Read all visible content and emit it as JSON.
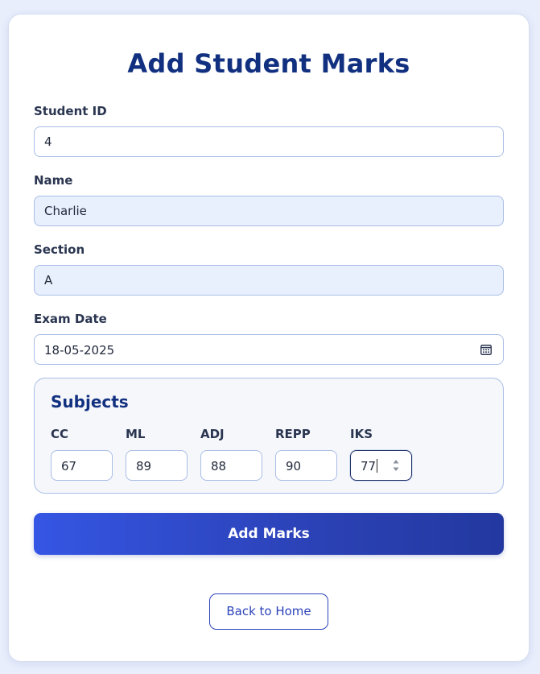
{
  "page": {
    "title": "Add Student Marks"
  },
  "form": {
    "student_id": {
      "label": "Student ID",
      "value": "4"
    },
    "name": {
      "label": "Name",
      "value": "Charlie"
    },
    "section": {
      "label": "Section",
      "value": "A"
    },
    "exam_date": {
      "label": "Exam Date",
      "value": "18-05-2025",
      "icon": "calendar-icon"
    }
  },
  "subjects": {
    "heading": "Subjects",
    "items": [
      {
        "label": "CC",
        "value": "67"
      },
      {
        "label": "ML",
        "value": "89"
      },
      {
        "label": "ADJ",
        "value": "88"
      },
      {
        "label": "REPP",
        "value": "90"
      },
      {
        "label": "IKS",
        "value": "77",
        "focused": true
      }
    ]
  },
  "actions": {
    "submit_label": "Add Marks",
    "back_label": "Back to Home"
  },
  "colors": {
    "background": "#e8eefc",
    "title": "#123080",
    "accent": "#2c43b9",
    "input_border": "#a9bde6",
    "readonly_fill": "#e8effd"
  }
}
